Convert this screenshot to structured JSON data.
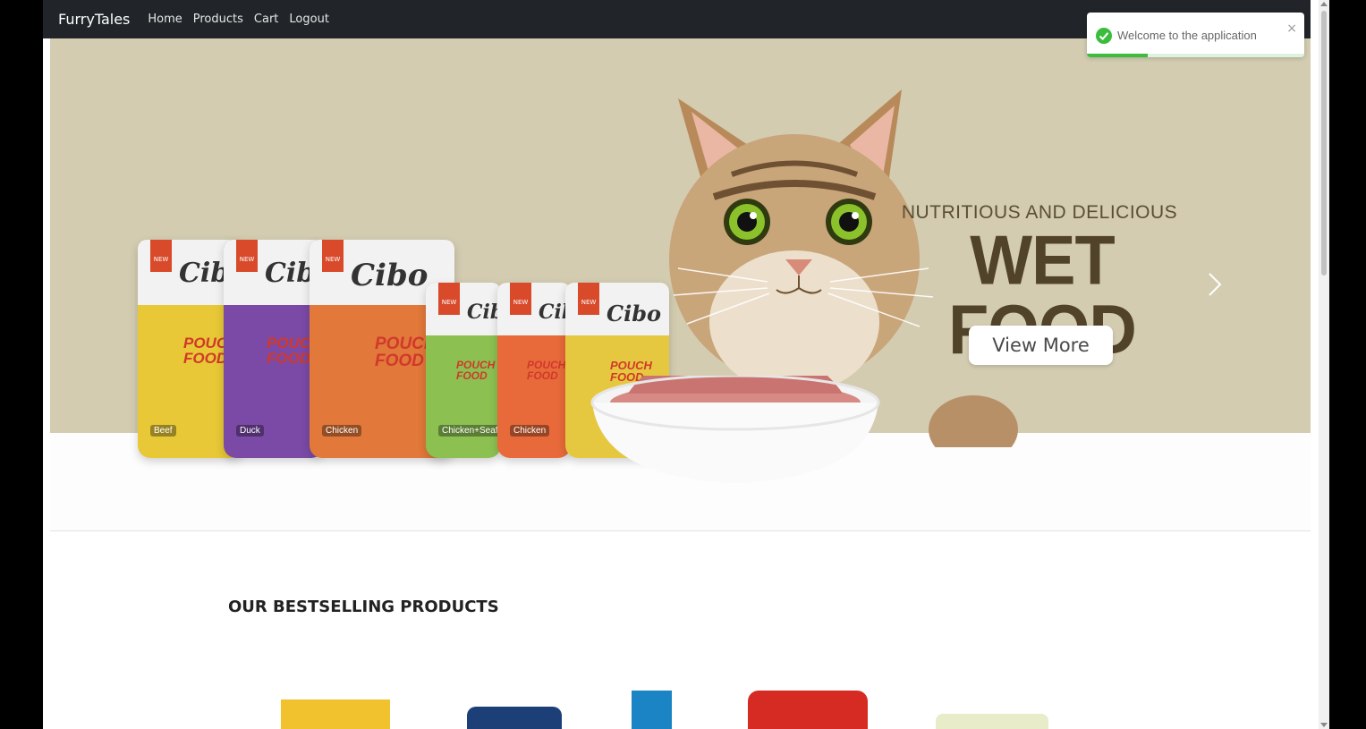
{
  "navbar": {
    "brand": "FurryTales",
    "links": [
      "Home",
      "Products",
      "Cart",
      "Logout"
    ]
  },
  "hero": {
    "subtitle": "NUTRITIOUS AND DELICIOUS",
    "title": "WET FOOD",
    "button_label": "View More",
    "packs": [
      {
        "label": "Cibo",
        "tag": "NEW",
        "food": "POUCH FOOD",
        "flavor": "Beef",
        "color": "#e8c836"
      },
      {
        "label": "Cibo",
        "tag": "NEW",
        "food": "POUCH FOOD",
        "flavor": "Duck",
        "color": "#7a4aa6"
      },
      {
        "label": "Cibo",
        "tag": "NEW",
        "food": "POUCH FOOD",
        "flavor": "Chicken",
        "color": "#e2783a"
      },
      {
        "label": "Cibo",
        "tag": "NEW",
        "food": "POUCH FOOD",
        "flavor": "Chicken+Seafood",
        "color": "#8cc152"
      },
      {
        "label": "Cibo",
        "tag": "NEW",
        "food": "POUCH FOOD",
        "flavor": "Chicken",
        "color": "#e86a3a"
      },
      {
        "label": "Cibo",
        "tag": "NEW",
        "food": "POUCH FOOD",
        "flavor": "",
        "color": "#e6c840"
      }
    ]
  },
  "toast": {
    "message": "Welcome to the application",
    "progress": 0.28,
    "icon": "check-circle-icon",
    "color": "#3cbc3c"
  },
  "section": {
    "title": "OUR BESTSELLING PRODUCTS"
  },
  "colors": {
    "navbar": "#212529",
    "hero_bg": "#d3ccb1",
    "hero_title": "#514329"
  }
}
